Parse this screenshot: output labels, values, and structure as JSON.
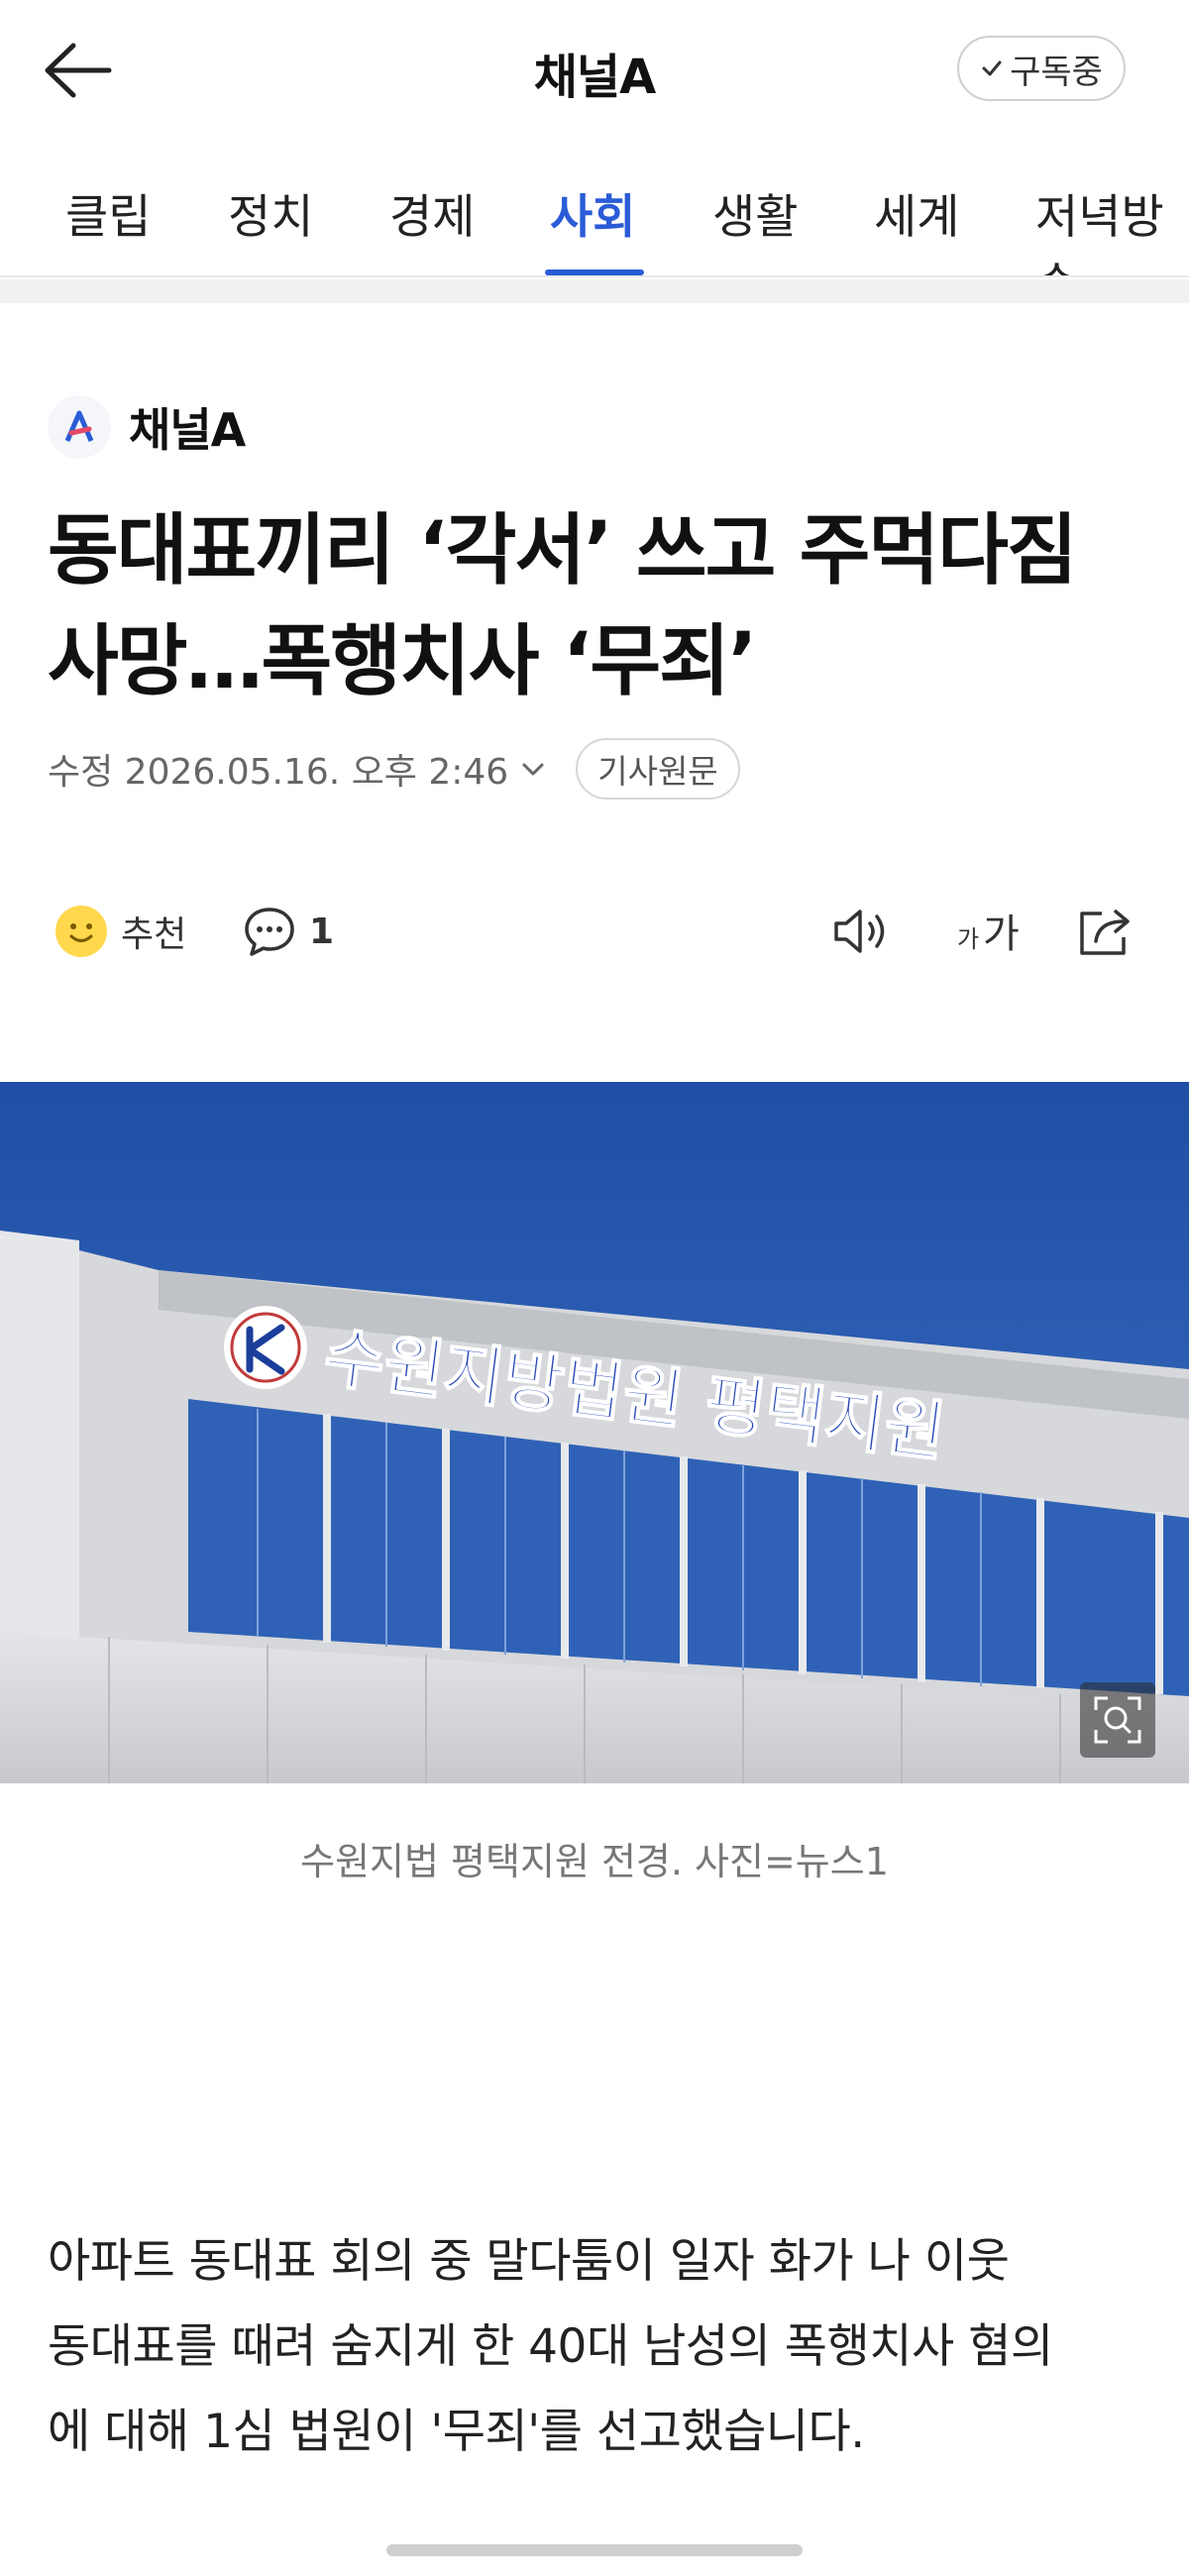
{
  "header": {
    "title": "채널A",
    "subscribe_label": "구독중"
  },
  "tabs": [
    {
      "label": "클립",
      "active": false
    },
    {
      "label": "정치",
      "active": false
    },
    {
      "label": "경제",
      "active": false
    },
    {
      "label": "사회",
      "active": true
    },
    {
      "label": "생활",
      "active": false
    },
    {
      "label": "세계",
      "active": false
    },
    {
      "label": "저녁방송",
      "active": false
    }
  ],
  "article": {
    "publisher": "채널A",
    "headline_line1": "동대표끼리 ‘각서’ 쓰고 주먹다짐",
    "headline_line2": "사망…폭행치사 ‘무죄’",
    "timestamp": "수정 2026.05.16. 오후 2:46",
    "original_label": "기사원문",
    "recommend_label": "추천",
    "comment_count": "1",
    "photo_sign_text": "수원지방법원 평택지원",
    "caption": "수원지법 평택지원 전경. 사진=뉴스1",
    "body_line1": "아파트 동대표 회의 중 말다툼이 일자 화가 나 이웃",
    "body_line2": "동대표를 때려 숨지게 한 40대 남성의 폭행치사 혐의",
    "body_line3": "에 대해 1심 법원이 '무죄'를 선고했습니다."
  },
  "icons": {
    "back": "arrow-left-icon",
    "check": "check-icon",
    "smile": "smile-icon",
    "comment": "comment-icon",
    "speaker": "speaker-icon",
    "font_size": "font-size-icon",
    "share": "share-icon",
    "zoom": "zoom-icon"
  },
  "colors": {
    "accent": "#2a5cd6",
    "sky": "#2f5fb0",
    "building": "#d9dadd"
  }
}
